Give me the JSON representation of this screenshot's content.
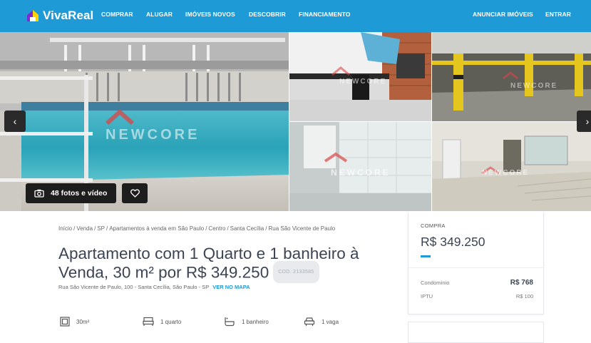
{
  "header": {
    "logo_text": "VivaReal",
    "nav": [
      "COMPRAR",
      "ALUGAR",
      "IMÓVEIS NOVOS",
      "DESCOBRIR",
      "FINANCIAMENTO"
    ],
    "right_nav": [
      "ANUNCIAR IMÓVEIS",
      "ENTRAR"
    ],
    "brand_color": "#1e9ad6"
  },
  "gallery": {
    "watermark": "NEWCORE",
    "photos_button_label": "48 fotos e vídeo",
    "prev_arrow": "‹",
    "next_arrow": "›"
  },
  "listing": {
    "breadcrumb": [
      "Início",
      "Venda",
      "SP",
      "Apartamentos à venda em São Paulo",
      "Centro",
      "Santa Cecília",
      "Rua São Vicente de Paulo"
    ],
    "title": "Apartamento com 1 Quarto e 1 banheiro à Venda, 30 m² por R$ 349.250",
    "code": "COD. 2133585",
    "address": "Rua São Vicente de Paulo, 100 - Santa Cecília, São Paulo - SP",
    "map_link": "VER NO MAPA",
    "features": [
      {
        "icon": "area-icon",
        "label": "30m²"
      },
      {
        "icon": "bed-icon",
        "label": "1 quarto"
      },
      {
        "icon": "bathtub-icon",
        "label": "1 banheiro"
      },
      {
        "icon": "car-icon",
        "label": "1 vaga"
      }
    ]
  },
  "price_card": {
    "label": "COMPRA",
    "price": "R$ 349.250",
    "rows": [
      {
        "key": "Condomínio",
        "value": "R$ 768"
      },
      {
        "key": "IPTU",
        "value": "R$ 100"
      }
    ]
  }
}
